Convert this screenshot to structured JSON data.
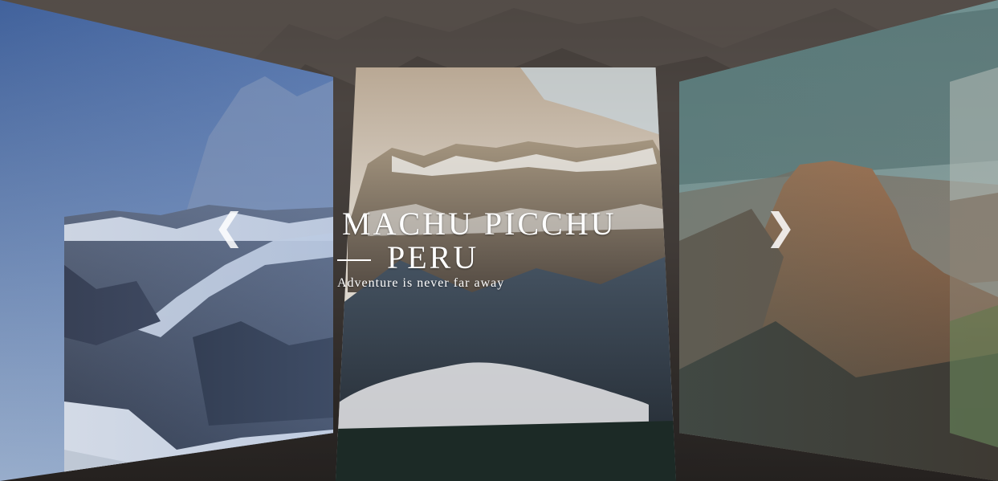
{
  "slider": {
    "current_slide": {
      "title": "MACHU PICCHU",
      "subtitle": "PERU",
      "tagline": "Adventure is never far away"
    },
    "prev_icon": "❮",
    "next_icon": "❯"
  },
  "colors": {
    "background": "#2b2624",
    "text": "#ffffff"
  }
}
